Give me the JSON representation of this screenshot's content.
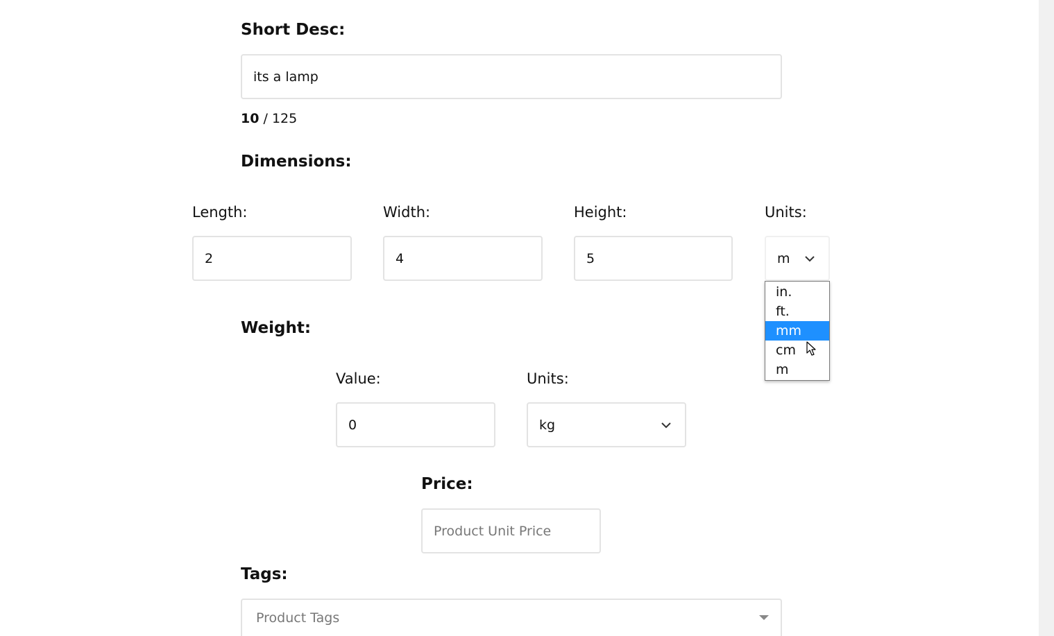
{
  "short_desc": {
    "label": "Short Desc:",
    "value": "its a lamp",
    "count_current": "10",
    "count_sep": " / ",
    "count_max": "125"
  },
  "dimensions": {
    "heading": "Dimensions:",
    "length_label": "Length:",
    "length_value": "2",
    "width_label": "Width:",
    "width_value": "4",
    "height_label": "Height:",
    "height_value": "5",
    "units_label": "Units:",
    "units_value": "m",
    "units_options": [
      "in.",
      "ft.",
      "mm",
      "cm",
      "m"
    ],
    "units_highlighted": "mm"
  },
  "weight": {
    "heading": "Weight:",
    "value_label": "Value:",
    "value": "0",
    "units_label": "Units:",
    "units_value": "kg"
  },
  "price": {
    "heading": "Price:",
    "placeholder": "Product Unit Price"
  },
  "tags": {
    "heading": "Tags:",
    "placeholder": "Product Tags"
  },
  "icons": {
    "select_chevron": "chevron-down-icon",
    "tags_caret": "caret-down-icon",
    "cursor": "mouse-pointer-icon"
  },
  "colors": {
    "option_highlight": "#1e90ff",
    "field_border": "#e3e3e3"
  }
}
